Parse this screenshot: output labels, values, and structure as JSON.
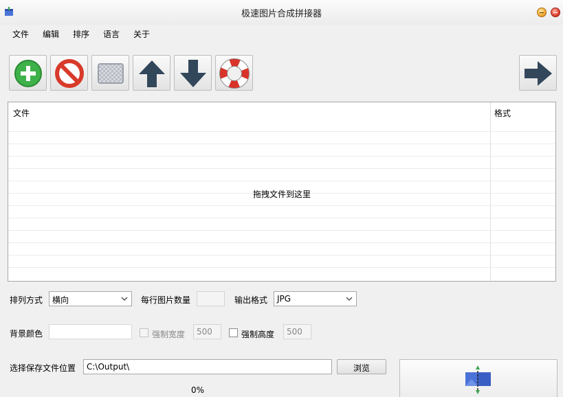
{
  "window": {
    "title": "极速图片合成拼接器"
  },
  "menu": {
    "items": [
      {
        "label": "文件"
      },
      {
        "label": "编辑"
      },
      {
        "label": "排序"
      },
      {
        "label": "语言"
      },
      {
        "label": "关于"
      }
    ]
  },
  "toolbar": {
    "buttons": [
      {
        "icon": "plus-circle-icon",
        "color": "#3fb14a"
      },
      {
        "icon": "no-entry-icon",
        "color": "#d83a2a"
      },
      {
        "icon": "checkerboard-icon",
        "color": "#b8bcc4"
      },
      {
        "icon": "arrow-up-icon",
        "color": "#33475b"
      },
      {
        "icon": "arrow-down-icon",
        "color": "#33475b"
      },
      {
        "icon": "lifebuoy-icon",
        "color": "#d8342a"
      }
    ],
    "next": {
      "icon": "arrow-right-icon",
      "color": "#33475b"
    }
  },
  "file_list": {
    "columns": [
      "文件",
      "格式"
    ],
    "drop_hint": "拖拽文件到这里"
  },
  "options": {
    "arrange_label": "排列方式",
    "arrange_value": "横向",
    "per_row_label": "每行图片数量",
    "per_row_value": "",
    "output_format_label": "输出格式",
    "output_format_value": "JPG",
    "bg_color_label": "背景颜色",
    "bg_color_value": "",
    "force_width_label": "强制宽度",
    "force_width_value": "500",
    "force_height_label": "强制高度",
    "force_height_value": "500"
  },
  "output": {
    "save_location_label": "选择保存文件位置",
    "save_path": "C:\\Output\\",
    "browse_label": "浏览",
    "progress_text": "0%",
    "progress": 0
  }
}
